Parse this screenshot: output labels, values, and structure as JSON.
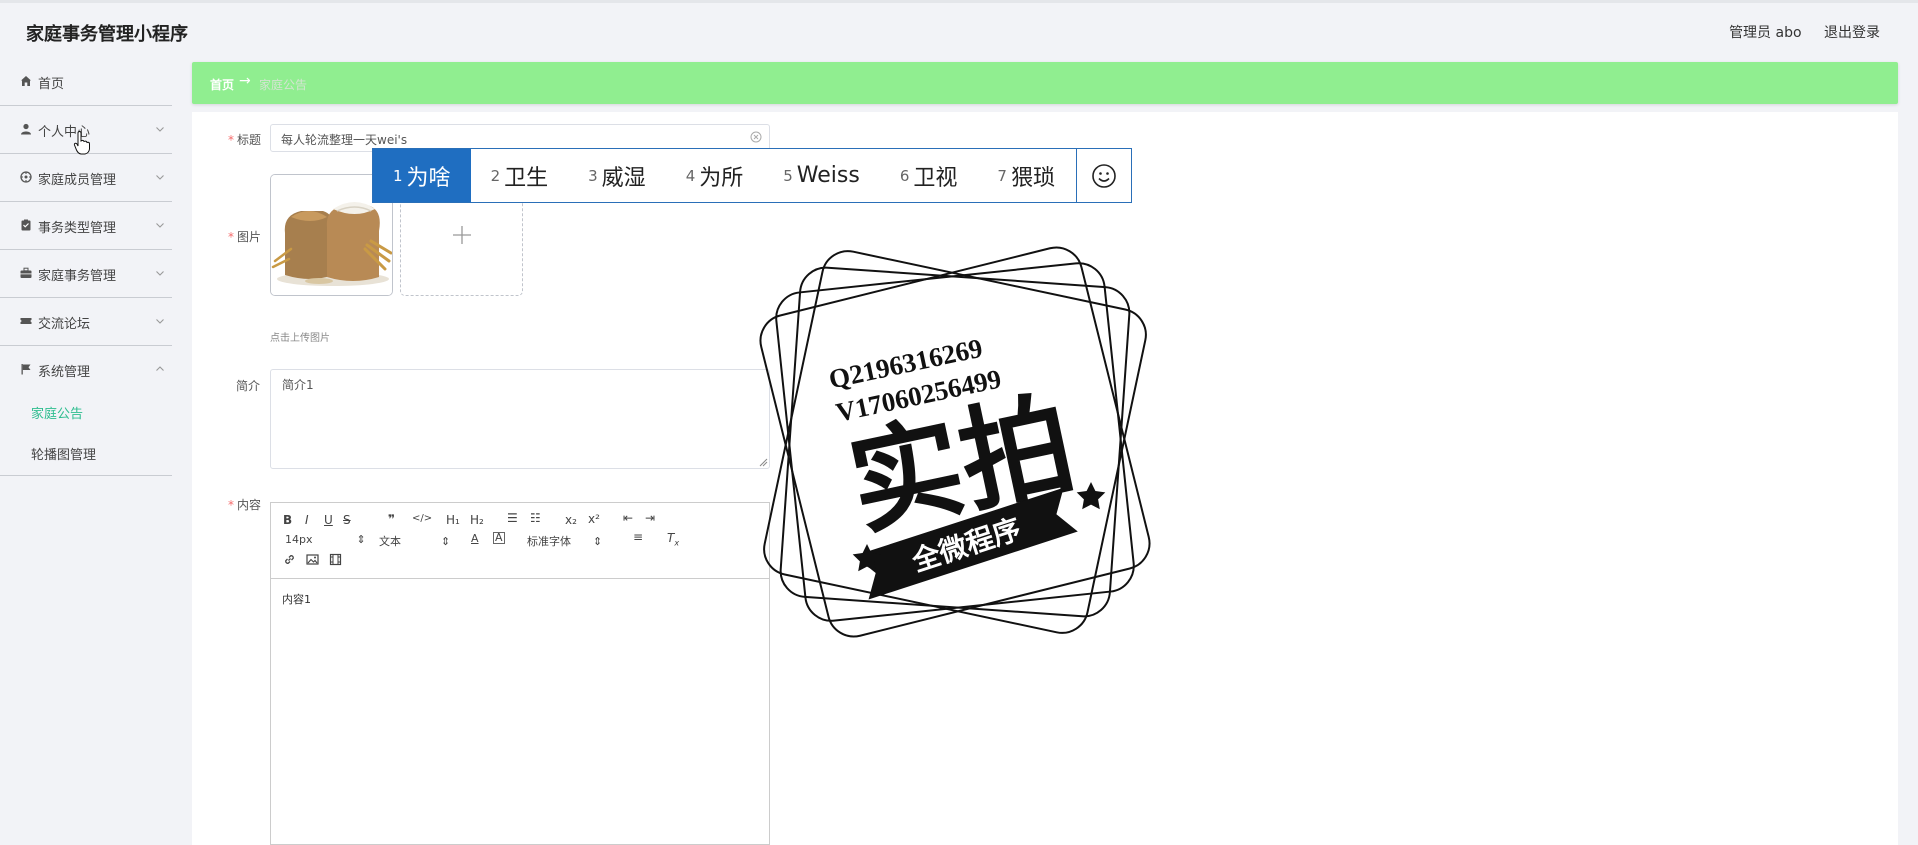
{
  "header": {
    "app_title": "家庭事务管理小程序",
    "admin_label": "管理员 abo",
    "logout_label": "退出登录"
  },
  "sidebar": {
    "items": [
      {
        "label": "首页",
        "icon": "home-icon",
        "expandable": false
      },
      {
        "label": "个人中心",
        "icon": "user-icon",
        "expandable": true
      },
      {
        "label": "家庭成员管理",
        "icon": "members-icon",
        "expandable": true
      },
      {
        "label": "事务类型管理",
        "icon": "clipboard-icon",
        "expandable": true
      },
      {
        "label": "家庭事务管理",
        "icon": "briefcase-icon",
        "expandable": true
      },
      {
        "label": "交流论坛",
        "icon": "ticket-icon",
        "expandable": true
      },
      {
        "label": "系统管理",
        "icon": "flag-icon",
        "expandable": true,
        "expanded": true
      }
    ],
    "subitems": [
      {
        "label": "家庭公告",
        "active": true
      },
      {
        "label": "轮播图管理",
        "active": false
      }
    ]
  },
  "breadcrumb": {
    "home": "首页",
    "separator": "→",
    "current": "家庭公告"
  },
  "form": {
    "title_label": "标题",
    "title_value": "每人轮流整理一天wei's",
    "image_label": "图片",
    "upload_hint": "点击上传图片",
    "summary_label": "简介",
    "summary_value": "简介1",
    "content_label": "内容",
    "content_value": "内容1",
    "editor": {
      "font_size": "14px",
      "text_style": "文本",
      "font_family": "标准字体"
    }
  },
  "ime": {
    "candidates": [
      {
        "num": "1",
        "text": "为啥",
        "selected": true
      },
      {
        "num": "2",
        "text": "卫生",
        "selected": false
      },
      {
        "num": "3",
        "text": "威湿",
        "selected": false
      },
      {
        "num": "4",
        "text": "为所",
        "selected": false
      },
      {
        "num": "5",
        "text": "Weiss",
        "selected": false
      },
      {
        "num": "6",
        "text": "卫视",
        "selected": false
      },
      {
        "num": "7",
        "text": "猥琐",
        "selected": false
      }
    ]
  },
  "watermark": {
    "line1": "Q2196316269",
    "line2": "V17060256499",
    "main": "实拍",
    "ribbon": "全微程序"
  },
  "colors": {
    "breadcrumb_bg": "#90ee90",
    "active_menu": "#2ebd8f",
    "ime_selected": "#1f6ec1",
    "required": "#f56c6c"
  }
}
